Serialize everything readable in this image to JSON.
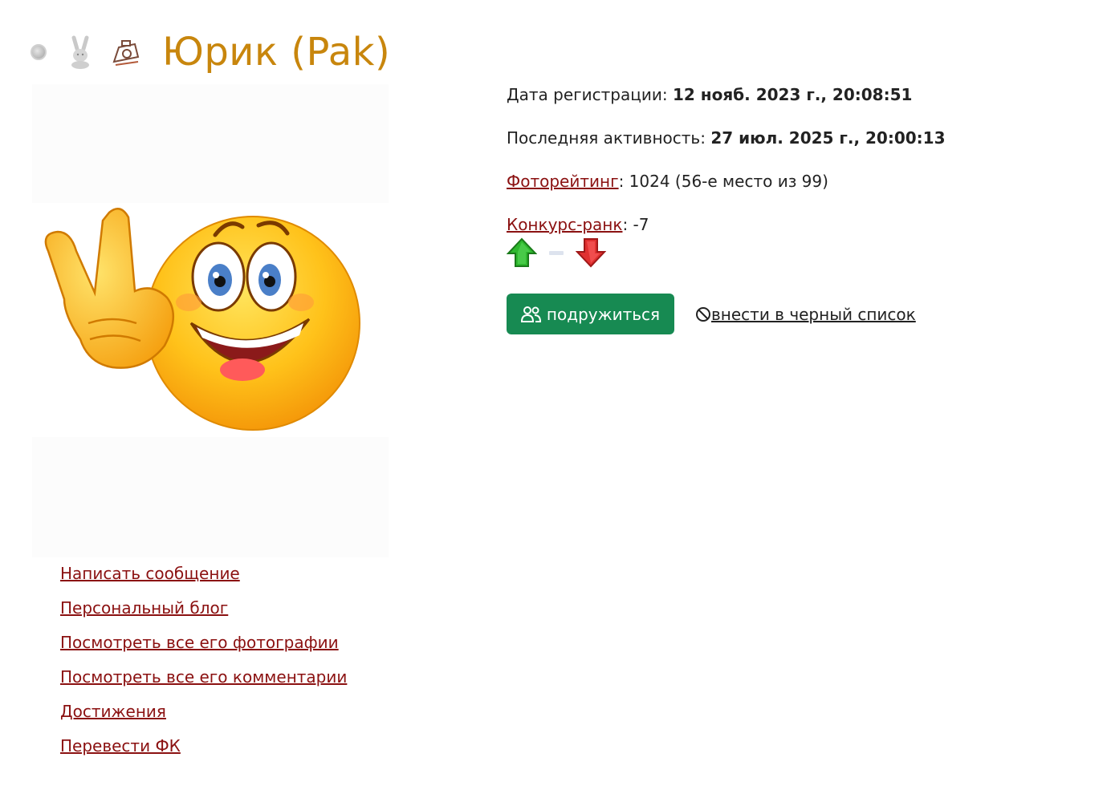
{
  "header": {
    "title": "Юрик (Pak)",
    "title_color": "#c8860d",
    "icons": [
      "status-dot-icon",
      "rabbit-icon",
      "photo-rating-icon"
    ]
  },
  "profile": {
    "reg_label": "Дата регистрации:",
    "reg_value": "12 нояб. 2023 г., 20:08:51",
    "activity_label": "Последняя активность:",
    "activity_value": "27 июл. 2025 г., 20:00:13",
    "photo_rating_link": "Фоторейтинг",
    "photo_rating_value": ": 1024 (56-е место из 99)",
    "contest_rank_link": "Конкурс-ранк",
    "contest_rank_value": ": -7"
  },
  "actions": {
    "friend_button": "подружиться",
    "blacklist_link": "внести в черный список",
    "friend_color": "#178a52"
  },
  "links": [
    "Написать сообщение",
    "Персональный блог",
    "Посмотреть все его фотографии",
    "Посмотреть все его комментарии",
    "Достижения",
    "Перевести ФК"
  ],
  "link_color": "#8b1111"
}
